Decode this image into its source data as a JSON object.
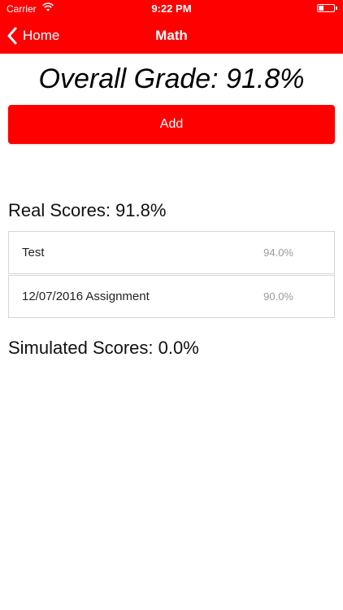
{
  "status_bar": {
    "carrier": "Carrier",
    "time": "9:22 PM",
    "battery_level": 0.3
  },
  "nav": {
    "back_label": "Home",
    "title": "Math"
  },
  "overall_grade": "Overall Grade: 91.8%",
  "add_label": "Add",
  "real_scores": {
    "title": "Real Scores: 91.8%",
    "items": [
      {
        "name": "Test",
        "value": "94.0%"
      },
      {
        "name": "12/07/2016 Assignment",
        "value": "90.0%"
      }
    ]
  },
  "simulated_scores": {
    "title": "Simulated Scores: 0.0%"
  },
  "colors": {
    "accent": "#ff0000",
    "background": "#ffffff",
    "muted_text": "#9a9a9a"
  },
  "icons": {
    "back": "chevron-left-icon",
    "wifi": "wifi-icon",
    "battery": "battery-icon"
  }
}
